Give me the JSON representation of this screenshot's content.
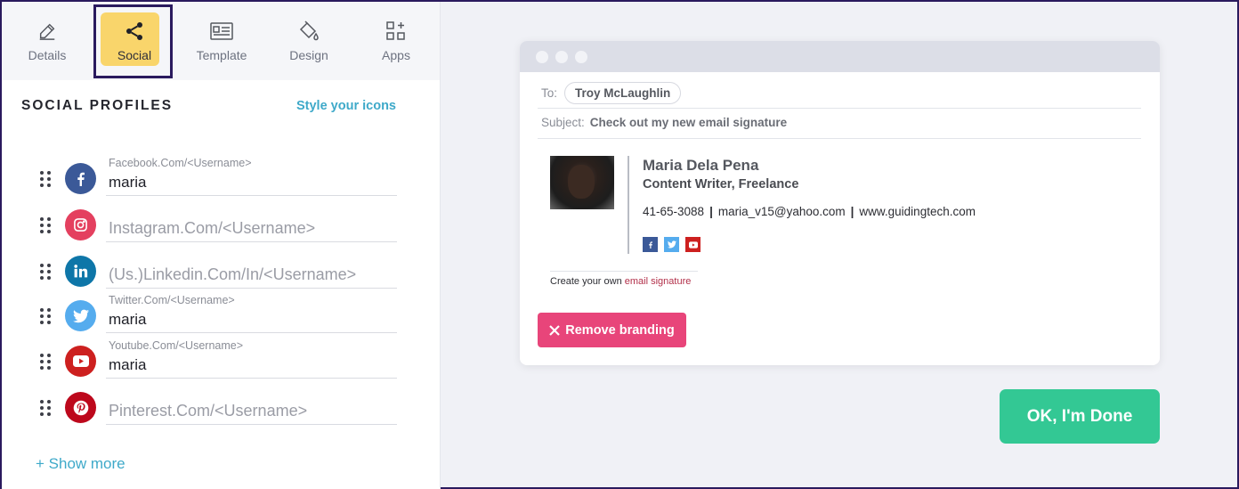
{
  "tabs": [
    {
      "label": "Details",
      "icon": "pencil-icon"
    },
    {
      "label": "Social",
      "icon": "share-icon",
      "active": true
    },
    {
      "label": "Template",
      "icon": "template-icon"
    },
    {
      "label": "Design",
      "icon": "paint-bucket-icon"
    },
    {
      "label": "Apps",
      "icon": "apps-grid-icon"
    }
  ],
  "social": {
    "title": "SOCIAL PROFILES",
    "style_link": "Style your icons",
    "show_more": "+ Show more",
    "profiles": [
      {
        "network": "facebook",
        "label": "Facebook.Com/<Username>",
        "value": "maria",
        "placeholder": "",
        "color": "#3b5998"
      },
      {
        "network": "instagram",
        "label": "",
        "value": "",
        "placeholder": "Instagram.Com/<Username>",
        "color": "#e4405f"
      },
      {
        "network": "linkedin",
        "label": "",
        "value": "",
        "placeholder": "(Us.)Linkedin.Com/In/<Username>",
        "color": "#0e76a8"
      },
      {
        "network": "twitter",
        "label": "Twitter.Com/<Username>",
        "value": "maria",
        "placeholder": "",
        "color": "#55acee"
      },
      {
        "network": "youtube",
        "label": "Youtube.Com/<Username>",
        "value": "maria",
        "placeholder": "",
        "color": "#cd201f"
      },
      {
        "network": "pinterest",
        "label": "",
        "value": "",
        "placeholder": "Pinterest.Com/<Username>",
        "color": "#bd081c"
      }
    ]
  },
  "preview": {
    "to_label": "To:",
    "to_value": "Troy McLaughlin",
    "subject_label": "Subject:",
    "subject_value": "Check out my new email signature",
    "signature": {
      "name": "Maria Dela Pena",
      "title": "Content Writer, Freelance",
      "phone": "41-65-3088",
      "sep": "|",
      "email": "maria_v15@yahoo.com",
      "website": "www.guidingtech.com"
    },
    "credit_text": "Create your own ",
    "credit_link": "email signature",
    "remove_branding": "Remove branding"
  },
  "done_button": "OK, I'm Done",
  "colors": {
    "active_tab": "#f9d56b",
    "accent_link": "#3ea9c9",
    "remove_btn": "#e8457a",
    "done_btn": "#33c894"
  }
}
